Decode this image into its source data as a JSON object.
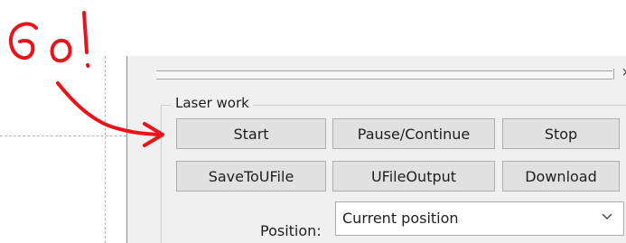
{
  "annotation": {
    "text": "Go!",
    "color": "#e8131b"
  },
  "group": {
    "title": "Laser work"
  },
  "buttons": {
    "start": "Start",
    "pause": "Pause/Continue",
    "stop": "Stop",
    "save_to_ufile": "SaveToUFile",
    "ufile_output": "UFileOutput",
    "download": "Download"
  },
  "position": {
    "label": "Position:",
    "value": "Current position"
  },
  "icons": {
    "close": "close-icon",
    "dropdown": "chevron-down-icon"
  }
}
